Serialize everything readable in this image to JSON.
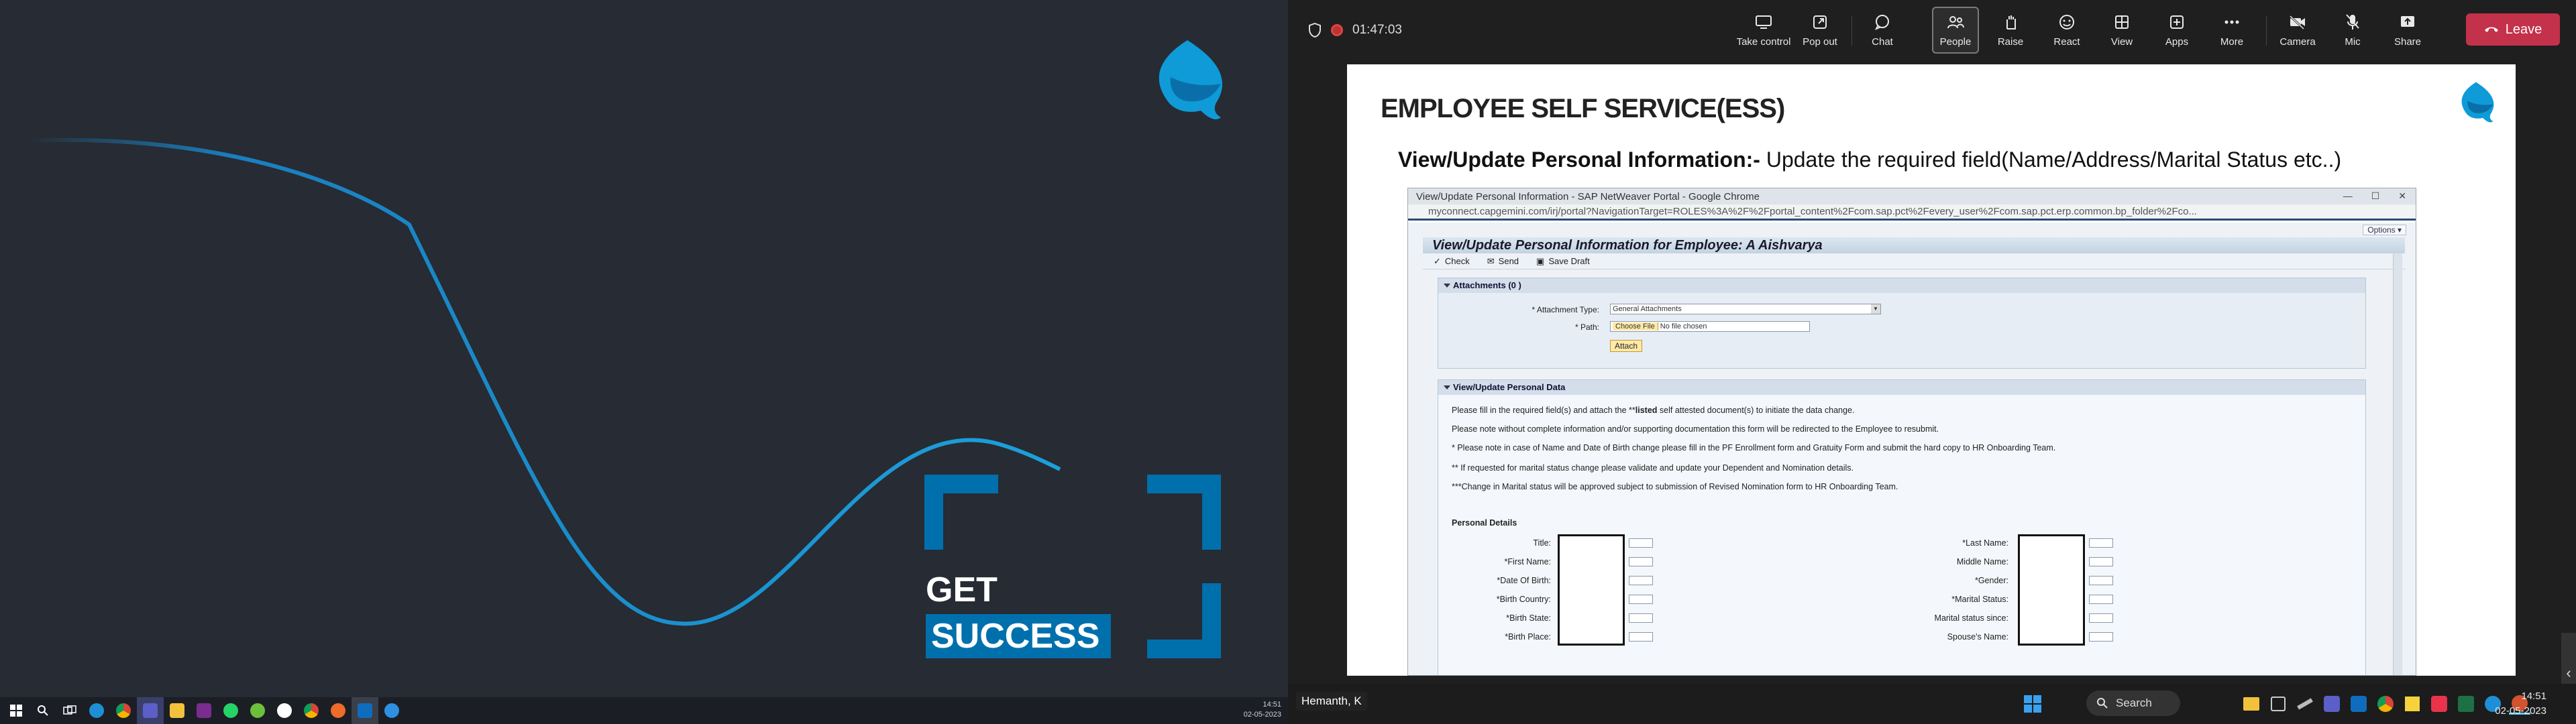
{
  "left_slide": {
    "get_label": "GET",
    "success_label": "SUCCESS",
    "brand_color": "#0070ad"
  },
  "left_taskbar": {
    "time": "14:51",
    "date": "02-05-2023",
    "apps": [
      "start-icon",
      "search-icon",
      "task-view-icon",
      "edge-icon",
      "chrome-icon",
      "teams-icon",
      "file-explorer-icon",
      "onenote-icon",
      "whatsapp-icon",
      "camera-icon",
      "clock-icon",
      "chrome-profile-icon",
      "outlook-icon",
      "network-icon"
    ]
  },
  "teams": {
    "timer": "01:47:03",
    "buttons": [
      {
        "label": "Take control",
        "icon": "take-control-icon"
      },
      {
        "label": "Pop out",
        "icon": "pop-out-icon"
      },
      {
        "label": "Chat",
        "icon": "chat-icon"
      },
      {
        "label": "People",
        "icon": "people-icon"
      },
      {
        "label": "Raise",
        "icon": "raise-hand-icon"
      },
      {
        "label": "React",
        "icon": "react-icon"
      },
      {
        "label": "View",
        "icon": "view-icon"
      },
      {
        "label": "Apps",
        "icon": "apps-icon"
      },
      {
        "label": "More",
        "icon": "more-icon"
      },
      {
        "label": "Camera",
        "icon": "camera-off-icon"
      },
      {
        "label": "Mic",
        "icon": "mic-off-icon"
      },
      {
        "label": "Share",
        "icon": "share-icon"
      }
    ],
    "leave_label": "Leave",
    "leave_color": "#c4314b"
  },
  "slide": {
    "title": "EMPLOYEE SELF SERVICE(ESS)",
    "subtitle_bold": "View/Update Personal Information:-",
    "subtitle_rest": " Update the required field(Name/Address/Marital Status etc..)"
  },
  "browser": {
    "window_title": "View/Update Personal Information - SAP NetWeaver Portal - Google Chrome",
    "url": "myconnect.capgemini.com/irj/portal?NavigationTarget=ROLES%3A%2F%2Fportal_content%2Fcom.sap.pct%2Fevery_user%2Fcom.sap.pct.erp.common.bp_folder%2Fco...",
    "options_label": "Options ▾"
  },
  "ess": {
    "header": "View/Update Personal Information for Employee: A Aishvarya",
    "toolbar": {
      "check": "Check",
      "send": "Send",
      "save_draft": "Save Draft"
    },
    "attachments": {
      "title": "Attachments (0 )",
      "type_label": "* Attachment Type:",
      "type_value": "General Attachments",
      "path_label": "* Path:",
      "choose_file": "Choose File",
      "no_file": "No file chosen",
      "attach": "Attach"
    },
    "personal_data_title": "View/Update Personal Data",
    "notes_pre": "Please fill in the required field(s) and attach the **",
    "notes_bold": "listed",
    "notes_post": " self attested document(s) to initiate the data change.",
    "notes": [
      "Please note without complete information and/or supporting documentation this form will be redirected to the Employee to resubmit.",
      "* Please note in case of Name and Date of Birth change please fill in the PF Enrollment form and Gratuity Form  and submit the hard copy to HR Onboarding Team.",
      "** If requested for marital status change please validate and update your Dependent and Nomination details.",
      "***Change in Marital status will be approved subject to submission of Revised Nomination form to HR Onboarding Team."
    ],
    "personal_details_title": "Personal Details",
    "left_fields": [
      "Title:",
      "*First Name:",
      "*Date Of Birth:",
      "*Birth Country:",
      "*Birth State:",
      "*Birth Place:"
    ],
    "right_fields": [
      "*Last Name:",
      "Middle Name:",
      "*Gender:",
      "*Marital Status:",
      "Marital status since:",
      "Spouse's Name:"
    ]
  },
  "right_taskbar": {
    "presenter": "Hemanth, K",
    "search": "Search",
    "time": "14:51",
    "date": "02-05-2023"
  }
}
